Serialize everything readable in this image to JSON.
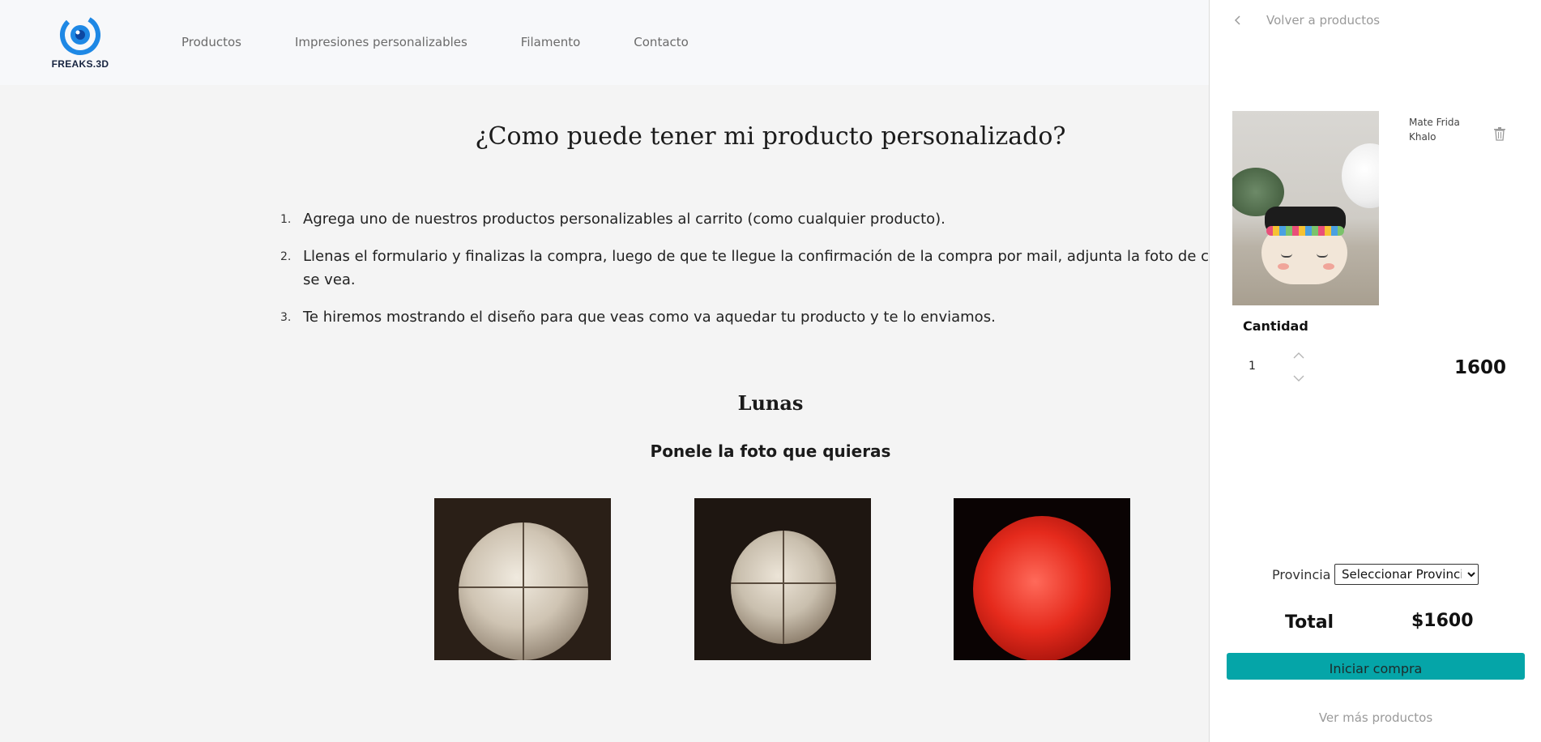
{
  "brand": {
    "name": "FREAKS.3D",
    "accent": "#1e88e5"
  },
  "nav": {
    "items": [
      "Productos",
      "Impresiones personalizables",
      "Filamento",
      "Contacto"
    ]
  },
  "main": {
    "title": "¿Como puede tener mi producto personalizado?",
    "steps": [
      {
        "num": "1.",
        "text": "Agrega uno de nuestros productos personalizables al carrito (como cualquier producto)."
      },
      {
        "num": "2.",
        "text": "Llenas el formulario y finalizas la compra, luego de que te llegue la confirmación de la compra por mail, adjunta la foto de como quieras que se vea."
      },
      {
        "num": "3.",
        "text": "Te hiremos mostrando el diseño para que veas como va aquedar tu producto y te lo enviamos."
      }
    ],
    "section_title": "Lunas",
    "section_subtitle": "Ponele la foto que quieras"
  },
  "cart": {
    "back_label": "Volver a productos",
    "item": {
      "name": "Mate Frida Khalo",
      "quantity_label": "Cantidad",
      "quantity": "1",
      "price": "1600"
    },
    "province_label": "Provincia",
    "province_selected": "Seleccionar Provincia",
    "total_label": "Total",
    "total_value": "$1600",
    "buy_label": "Iniciar compra",
    "more_label": "Ver más productos",
    "button_color": "#05a5a8"
  }
}
